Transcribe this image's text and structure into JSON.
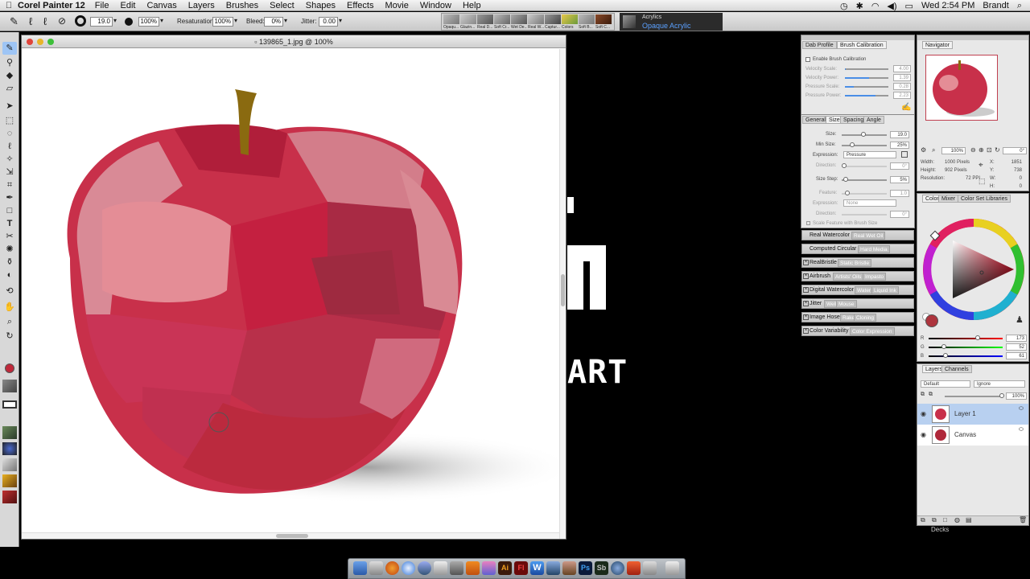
{
  "menubar": {
    "apple": "",
    "app_name": "Corel Painter 12",
    "items": [
      "File",
      "Edit",
      "Canvas",
      "Layers",
      "Brushes",
      "Select",
      "Shapes",
      "Effects",
      "Movie",
      "Window",
      "Help"
    ],
    "clock": "Wed 2:54 PM",
    "user": "Brandt"
  },
  "propbar": {
    "size_value": "19.0",
    "opacity_value": "100%",
    "resaturation_label": "Resaturation:",
    "resaturation_value": "100%",
    "bleed_label": "Bleed:",
    "bleed_value": "0%",
    "jitter_label": "Jitter:",
    "jitter_value": "0.00",
    "presets": [
      "Opaqu...",
      "Glazin...",
      "Real D...",
      "Soft Cr...",
      "Wet De...",
      "Real W...",
      "Captur...",
      "Colors",
      "Soft B...",
      "Soft C..."
    ],
    "category": "Acrylics",
    "variant": "Opaque Acrylic"
  },
  "document": {
    "title": "139865_1.jpg @ 100%"
  },
  "background_text": {
    "art": "ART"
  },
  "brush_calibration": {
    "tabs": [
      "Dab Profile",
      "Brush Calibration"
    ],
    "enable_label": "Enable Brush Calibration",
    "rows": [
      {
        "label": "Velocity Scale:",
        "value": "4.00",
        "level": 0.02
      },
      {
        "label": "Velocity Power:",
        "value": "1.39",
        "level": 0.55
      },
      {
        "label": "Pressure Scale:",
        "value": "0.28",
        "level": 0.2
      },
      {
        "label": "Pressure Power:",
        "value": "2.23",
        "level": 0.7
      }
    ]
  },
  "size_panel": {
    "tabs": [
      "General",
      "Size",
      "Spacing",
      "Angle"
    ],
    "size_label": "Size:",
    "size_value": "19.0",
    "min_size_label": "Min Size:",
    "min_size_value": "25%",
    "expression_label": "Expression:",
    "expression_value": "Pressure",
    "direction_label": "Direction:",
    "direction_value": "0°",
    "size_step_label": "Size Step:",
    "size_step_value": "5%",
    "feature_label": "Feature:",
    "feature_value": "1.0",
    "expression2_label": "Expression:",
    "expression2_value": "None",
    "direction2_label": "Direction:",
    "direction2_value": "0°",
    "scale_label": "Scale Feature with Brush Size"
  },
  "palette_rows": [
    {
      "name": "Real Watercolor",
      "sub": "Real Wet Oil"
    },
    {
      "name": "Computed Circular",
      "sub": "Hard Media"
    },
    {
      "name": "RealBristle",
      "sub": "Static Bristle"
    },
    {
      "name": "Airbrush",
      "sub": "Artists' Oils",
      "sub2": "Impasto"
    },
    {
      "name": "Digital Watercolor",
      "sub": "Water",
      "sub2": "Liquid Ink"
    },
    {
      "name": "Jitter",
      "sub": "Well",
      "sub2": "Mouse"
    },
    {
      "name": "Image Hose",
      "sub": "Rake",
      "sub2": "Cloning"
    },
    {
      "name": "Color Variability",
      "sub": "Color Expression"
    }
  ],
  "navigator": {
    "title": "Navigator",
    "zoom": "100%",
    "rotation": "0°",
    "width_label": "Width:",
    "width_value": "1000 Pixels",
    "height_label": "Height:",
    "height_value": "902 Pixels",
    "resolution_label": "Resolution:",
    "resolution_value": "72 PPI",
    "x_label": "X:",
    "x_value": "1851",
    "y_label": "Y:",
    "y_value": "738",
    "w_label": "W:",
    "w_value": "0",
    "h_label": "H:",
    "h_value": "0"
  },
  "color_panel": {
    "tabs": [
      "Color",
      "Mixer",
      "Color Set Libraries"
    ],
    "r_label": "R",
    "r_value": "173",
    "g_label": "G",
    "g_value": "52",
    "b_label": "B",
    "b_value": "61",
    "current_color": "#ad343d"
  },
  "layers_panel": {
    "tabs": [
      "Layers",
      "Channels"
    ],
    "composite": "Default",
    "preserve": "Ignore",
    "opacity": "100%",
    "layers": [
      {
        "name": "Layer 1",
        "selected": true
      },
      {
        "name": "Canvas",
        "selected": false
      }
    ]
  },
  "decks_label": "Decks"
}
